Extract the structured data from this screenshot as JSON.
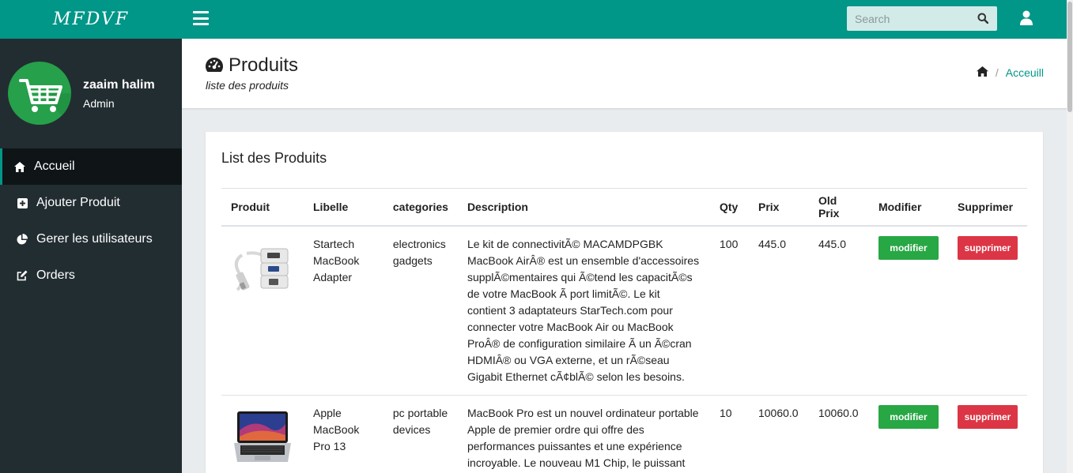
{
  "brand": {
    "name": "MFDVF"
  },
  "user": {
    "name": "zaaim halim",
    "role": "Admin"
  },
  "sidebar": {
    "items": [
      {
        "label": "Accueil",
        "icon": "home-icon",
        "active": true
      },
      {
        "label": "Ajouter Produit",
        "icon": "plus-square-icon",
        "active": false
      },
      {
        "label": "Gerer les utilisateurs",
        "icon": "pie-chart-icon",
        "active": false
      },
      {
        "label": "Orders",
        "icon": "edit-icon",
        "active": false
      }
    ]
  },
  "topbar": {
    "search_placeholder": "Search"
  },
  "header": {
    "title": "Produits",
    "subtitle": "liste des produits",
    "breadcrumb_current": "Acceuill"
  },
  "card": {
    "title": "List des Produits"
  },
  "table": {
    "columns": [
      "Produit",
      "Libelle",
      "categories",
      "Description",
      "Qty",
      "Prix",
      "Old Prix",
      "Modifier",
      "Supprimer"
    ],
    "rows": [
      {
        "image": "startech-adapter-image",
        "libelle": "Startech MacBook Adapter",
        "categories": "electronics gadgets",
        "description": "Le kit de connectivitÃ© MACAMDPGBK MacBook AirÂ® est un ensemble d'accessoires supplÃ©mentaires qui Ã©tend les capacitÃ©s de votre MacBook Ã  port limitÃ©. Le kit contient 3 adaptateurs StarTech.com pour connecter votre MacBook Air ou MacBook ProÂ® de configuration similaire Ã  un Ã©cran HDMIÂ® ou VGA externe, et un rÃ©seau Gigabit Ethernet cÃ¢blÃ© selon les besoins.",
        "qty": "100",
        "prix": "445.0",
        "old_prix": "445.0",
        "modifier": "modifier",
        "supprimer": "supprimer"
      },
      {
        "image": "macbook-pro-image",
        "libelle": "Apple MacBook Pro 13",
        "categories": "pc portable devices",
        "description": "MacBook Pro est un nouvel ordinateur portable Apple de premier ordre qui offre des performances puissantes et une expérience incroyable. Le nouveau M1 Chip, le puissant",
        "qty": "10",
        "prix": "10060.0",
        "old_prix": "10060.0",
        "modifier": "modifier",
        "supprimer": "supprimer"
      }
    ]
  },
  "colors": {
    "primary": "#009688",
    "sidebar": "#222d32",
    "sidebar_active": "#0f1416",
    "success": "#28a745",
    "danger": "#dc3545"
  }
}
